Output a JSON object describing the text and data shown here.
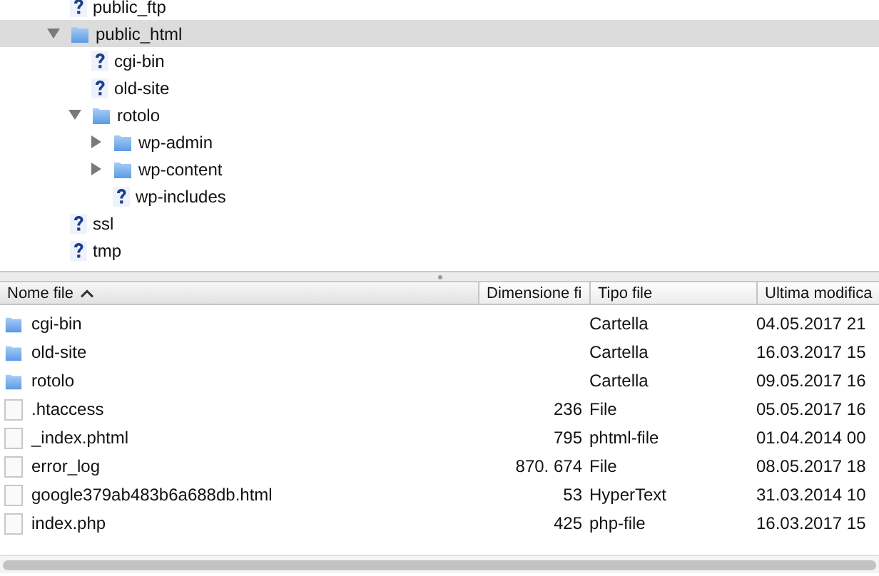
{
  "tree": [
    {
      "label": "public_ftp",
      "kind": "unknown",
      "selected": false
    },
    {
      "label": "public_html",
      "kind": "folder",
      "selected": true,
      "expanded": true,
      "children": [
        {
          "label": "cgi-bin",
          "kind": "unknown",
          "selected": false
        },
        {
          "label": "old-site",
          "kind": "unknown",
          "selected": false
        },
        {
          "label": "rotolo",
          "kind": "folder",
          "selected": false,
          "expanded": true,
          "children": [
            {
              "label": "wp-admin",
              "kind": "folder",
              "selected": false,
              "expanded": false
            },
            {
              "label": "wp-content",
              "kind": "folder",
              "selected": false,
              "expanded": false
            },
            {
              "label": "wp-includes",
              "kind": "unknown",
              "selected": false
            }
          ]
        }
      ]
    },
    {
      "label": "ssl",
      "kind": "unknown",
      "selected": false
    },
    {
      "label": "tmp",
      "kind": "unknown",
      "selected": false
    }
  ],
  "table": {
    "columns": [
      {
        "label": "Nome file",
        "sorted": true
      },
      {
        "label": "Dimensione fi"
      },
      {
        "label": "Tipo file"
      },
      {
        "label": "Ultima modifica"
      }
    ],
    "rows": [
      {
        "kind": "folder",
        "name": "cgi-bin",
        "type": "Cartella",
        "modified": "04.05.2017 21"
      },
      {
        "kind": "folder",
        "name": "old-site",
        "type": "Cartella",
        "modified": "16.03.2017 15"
      },
      {
        "kind": "folder",
        "name": "rotolo",
        "type": "Cartella",
        "modified": "09.05.2017 16"
      },
      {
        "kind": "file",
        "name": ".htaccess",
        "size": "236",
        "type": "File",
        "modified": "05.05.2017 16"
      },
      {
        "kind": "file",
        "name": "_index.phtml",
        "size": "795",
        "type": "phtml-file",
        "modified": "01.04.2014 00"
      },
      {
        "kind": "file",
        "name": "error_log",
        "size": "870. 674",
        "type": "File",
        "modified": "08.05.2017 18"
      },
      {
        "kind": "file",
        "name": "google379ab483b6a688db.html",
        "size": "53",
        "type": "HyperText",
        "modified": "31.03.2014 10"
      },
      {
        "kind": "file",
        "name": "index.php",
        "size": "425",
        "type": "php-file",
        "modified": "16.03.2017 15"
      }
    ]
  }
}
